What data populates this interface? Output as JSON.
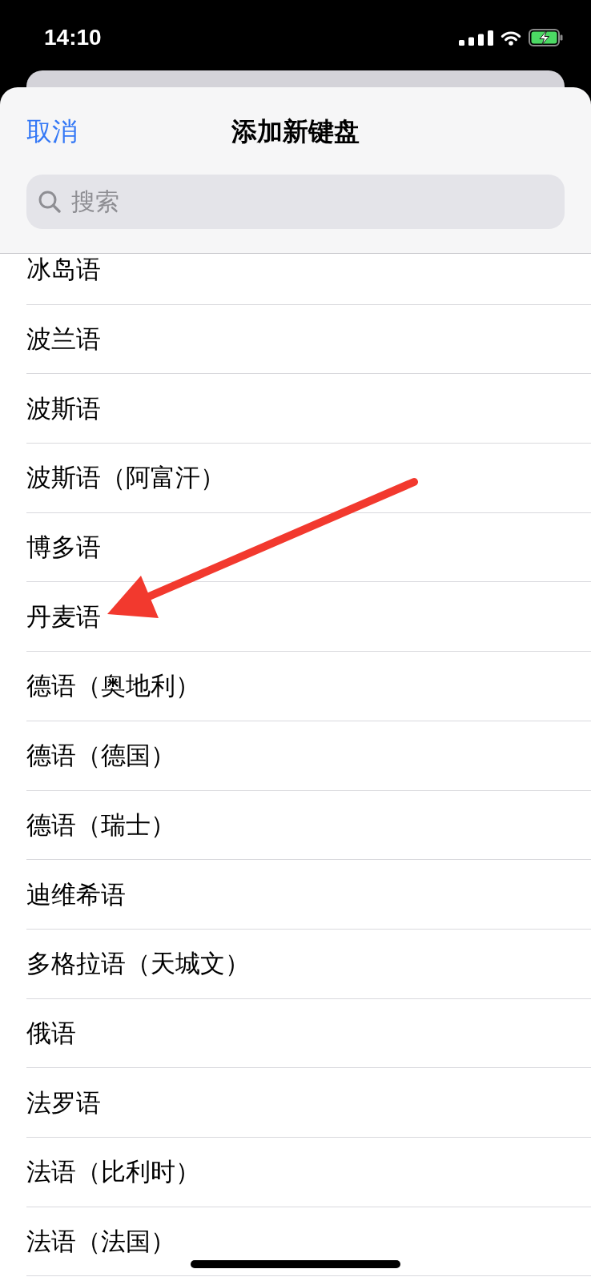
{
  "status_bar": {
    "time": "14:10"
  },
  "sheet": {
    "cancel_button": "取消",
    "title": "添加新键盘",
    "search": {
      "placeholder": "搜索"
    }
  },
  "languages": [
    "冰岛语",
    "波兰语",
    "波斯语",
    "波斯语（阿富汗）",
    "博多语",
    "丹麦语",
    "德语（奥地利）",
    "德语（德国）",
    "德语（瑞士）",
    "迪维希语",
    "多格拉语（天城文）",
    "俄语",
    "法罗语",
    "法语（比利时）",
    "法语（法国）"
  ]
}
